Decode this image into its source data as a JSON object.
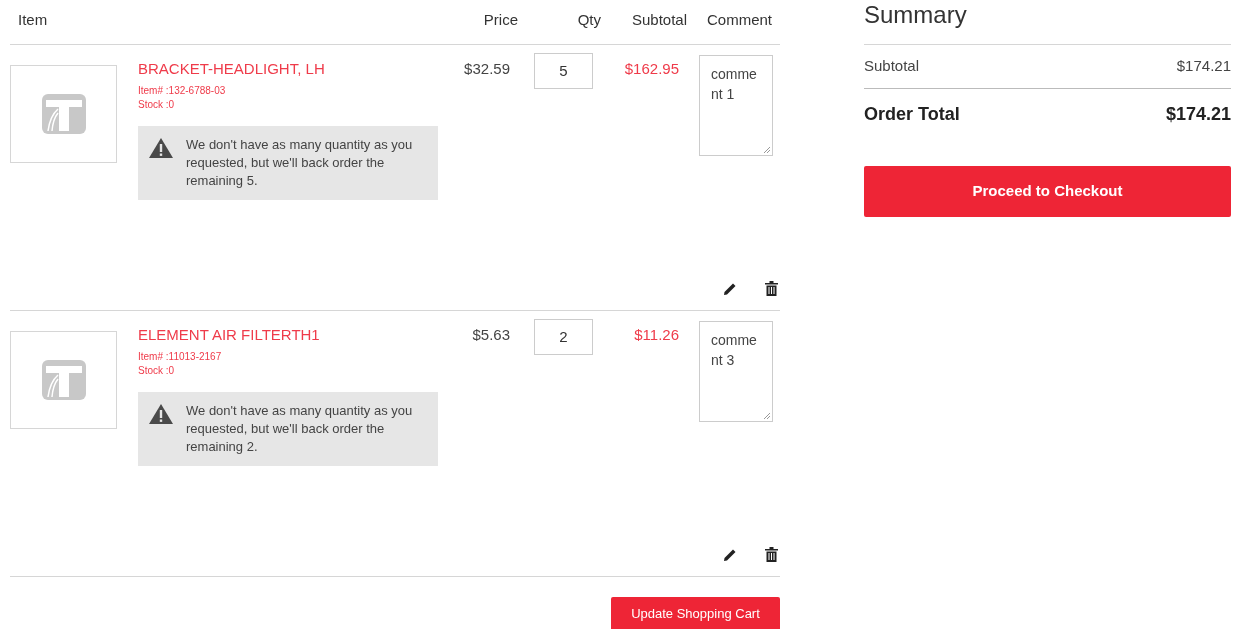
{
  "cart": {
    "columns": [
      "Item",
      "Price",
      "Qty",
      "Subtotal",
      "Comment"
    ],
    "rows": [
      {
        "name": "BRACKET-HEADLIGHT, LH",
        "item_no": "Item# :132-6788-03",
        "stock": "Stock :0",
        "warning": "We don't have as many quantity as you requested, but we'll back order the remaining 5.",
        "price": "$32.59",
        "qty": "5",
        "subtotal": "$162.95",
        "comment": "comment 1"
      },
      {
        "name": "ELEMENT AIR FILTERTH1",
        "item_no": "Item# :11013-2167",
        "stock": "Stock :0",
        "warning": "We don't have as many quantity as you requested, but we'll back order the remaining 2.",
        "price": "$5.63",
        "qty": "2",
        "subtotal": "$11.26",
        "comment": "comment 3"
      }
    ],
    "update_button": "Update Shopping Cart"
  },
  "summary": {
    "title": "Summary",
    "subtotal_label": "Subtotal",
    "subtotal": "$174.21",
    "total_label": "Order Total",
    "total": "$174.21",
    "checkout_button": "Proceed to Checkout"
  }
}
